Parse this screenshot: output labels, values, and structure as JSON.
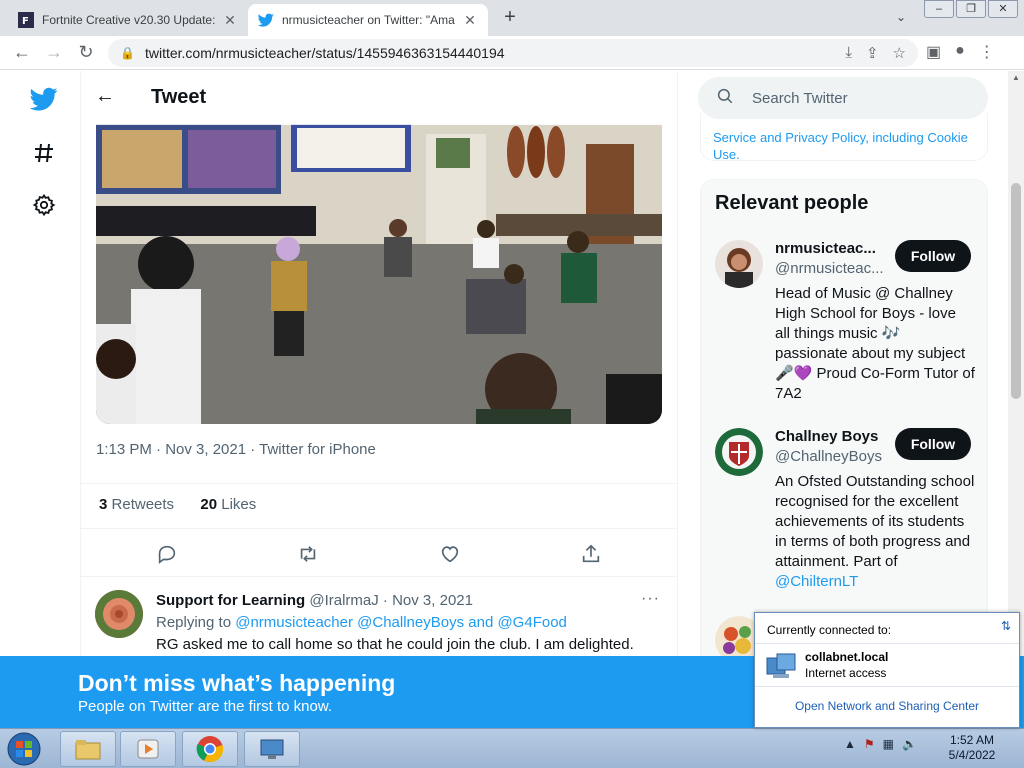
{
  "browser": {
    "tabs": [
      {
        "title": "Fortnite Creative v20.30 Update:",
        "active": false
      },
      {
        "title": "nrmusicteacher on Twitter: \"Ama",
        "active": true
      }
    ],
    "url": "twitter.com/nrmusicteacher/status/1455946363154440194",
    "new_tab_label": "+"
  },
  "twitter": {
    "page_title": "Tweet",
    "tweet": {
      "meta": "1:13 PM · Nov 3, 2021 · Twitter for iPhone",
      "retweets_count": "3",
      "retweets_label": "Retweets",
      "likes_count": "20",
      "likes_label": "Likes"
    },
    "reply": {
      "name": "Support for Learning",
      "handle": "@IralrmaJ",
      "date": "· Nov 3, 2021",
      "replying_prefix": "Replying to",
      "replying_to": "@nrmusicteacher @ChallneyBoys and @G4Food",
      "text": "RG asked me to call home so that he could join the club. I am delighted."
    },
    "search_placeholder": "Search Twitter",
    "policy_fragment": "Service and Privacy Policy, including Cookie Use.",
    "relevant_people": {
      "title": "Relevant people",
      "people": [
        {
          "name": "nrmusicteac...",
          "handle": "@nrmusicteac...",
          "follow_label": "Follow",
          "bio": "Head of Music @ Challney High School for Boys - love all things music 🎶 passionate about my subject 🎤💜 Proud Co-Form Tutor of 7A2"
        },
        {
          "name": "Challney Boys",
          "handle": "@ChallneyBoys",
          "follow_label": "Follow",
          "bio": "An Ofsted Outstanding school recognised for the excellent achievements of its students in terms of both progress and attainment. Part of ",
          "bio_link": "@ChilternLT"
        }
      ]
    },
    "banner": {
      "title": "Don’t miss what’s happening",
      "subtitle": "People on Twitter are the first to know."
    }
  },
  "network_popup": {
    "header": "Currently connected to:",
    "network_name": "collabnet.local",
    "access": "Internet access",
    "link": "Open Network and Sharing Center"
  },
  "taskbar": {
    "time": "1:52 AM",
    "date": "5/4/2022"
  },
  "colors": {
    "twitter_blue": "#1d9bf0",
    "text_primary": "#0f1419",
    "text_secondary": "#536471"
  }
}
